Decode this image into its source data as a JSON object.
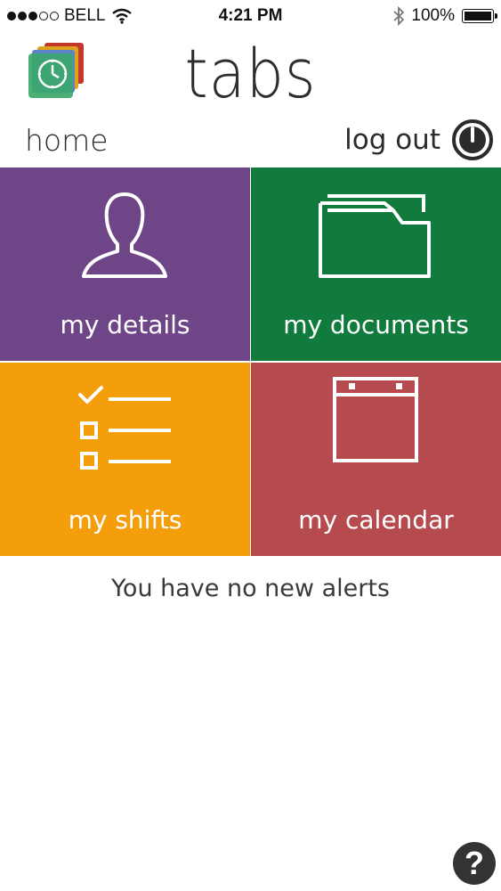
{
  "status_bar": {
    "carrier": "BELL",
    "time": "4:21 PM",
    "battery_percent": "100%",
    "battery_level": 1.0,
    "signal_bars_filled": 3,
    "signal_bars_total": 5
  },
  "header": {
    "title": "tabs",
    "logo_icon": "clock-logo-icon"
  },
  "nav": {
    "home_label": "home",
    "logout_label": "log out",
    "logout_icon": "power-icon"
  },
  "tiles": [
    {
      "label": "my details",
      "icon": "user-icon",
      "color": "#6e4587"
    },
    {
      "label": "my documents",
      "icon": "folder-icon",
      "color": "#117a3d"
    },
    {
      "label": "my shifts",
      "icon": "checklist-icon",
      "color": "#f59e0b"
    },
    {
      "label": "my calendar",
      "icon": "calendar-icon",
      "color": "#b54b4e"
    }
  ],
  "alerts": {
    "message": "You have no new alerts"
  },
  "help": {
    "label": "?"
  }
}
